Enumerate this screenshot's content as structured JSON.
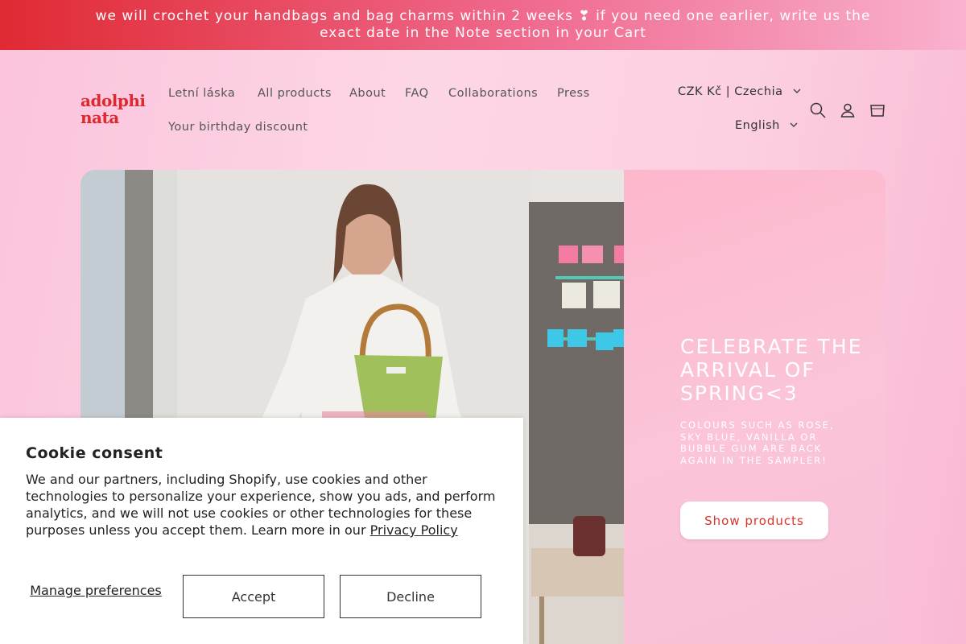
{
  "announcement": "we will crochet your handbags and bag charms within 2 weeks ❣ if you need one earlier, write us the exact date in the Note section in your Cart",
  "logo": "adolphi nata",
  "nav": [
    "Letní láska",
    "All products",
    "About",
    "FAQ",
    "Collaborations",
    "Press",
    "Your birthday discount"
  ],
  "country_selector": "CZK Kč | Czechia",
  "language_selector": "English",
  "icons": {
    "search": "search-icon",
    "account": "account-icon",
    "cart": "cart-icon",
    "chevron": "chevron-down-icon"
  },
  "hero": {
    "title": "CELEBRATE THE ARRIVAL OF SPRING<3",
    "subtitle": "COLOURS SUCH AS ROSE, SKY BLUE, VANILLA OR BUBBLE GUM ARE BACK AGAIN IN THE SAMPLER!",
    "button": "Show products"
  },
  "cookie": {
    "title": "Cookie consent",
    "body": "We and our partners, including Shopify, use cookies and other technologies to personalize your experience, show you ads, and perform analytics, and we will not use cookies or other technologies for these purposes unless you accept them. Learn more in our",
    "link": "Privacy Policy",
    "manage": "Manage preferences",
    "accept": "Accept",
    "decline": "Decline"
  },
  "colors": {
    "brand_red": "#e0282c",
    "button_text": "#d9342b",
    "panel_pink": "#fbc4d8"
  }
}
